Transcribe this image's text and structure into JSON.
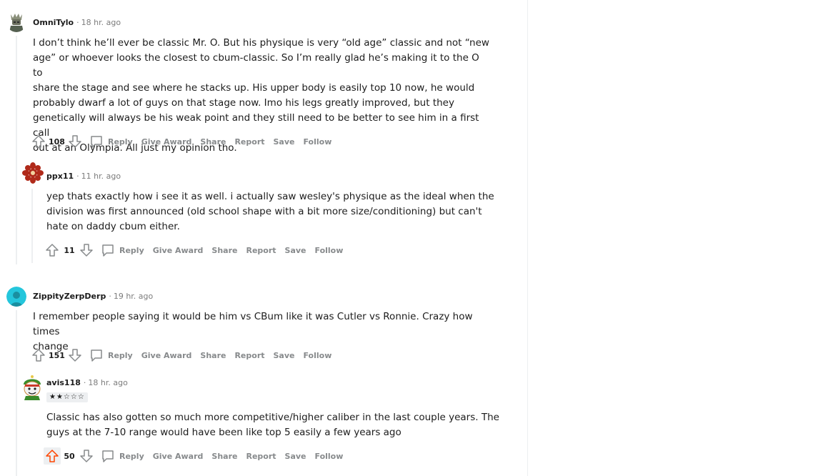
{
  "comments": [
    {
      "author": "OmniTylo",
      "time": "18 hr. ago",
      "body_lines": [
        "I don’t think he’ll ever be classic Mr. O. But his physique is very “old age” classic and not “new",
        "age” or whoever looks the closest to cbum-classic. So I’m really glad he’s making it to the O to",
        "share the stage and see where he stacks up. His upper body is easily top 10 now, he would",
        "probably dwarf a lot of guys on that stage now. Imo his legs greatly improved, but they",
        "genetically will always be his weak point and they still need to be better to see him in a first call",
        "out at an Olympia. All just my opinion tho."
      ],
      "votes": "108"
    },
    {
      "author": "ppx11",
      "time": "11 hr. ago",
      "body_lines": [
        "yep thats exactly how i see it as well. i actually saw wesley's physique as the ideal when the",
        "division was first announced (old school shape with a bit more size/conditioning) but can't",
        "hate on daddy cbum either."
      ],
      "votes": "11"
    },
    {
      "author": "ZippityZerpDerp",
      "time": "19 hr. ago",
      "body_lines": [
        "I remember people saying it would be him vs CBum like it was Cutler vs Ronnie. Crazy how times",
        "change"
      ],
      "votes": "151"
    },
    {
      "author": "avis118",
      "time": "18 hr. ago",
      "flair": "★★☆☆☆",
      "body_lines": [
        "Classic has also gotten so much more competitive/higher caliber in the last couple years. The",
        "guys at the 7-10 range would have been like top 5 easily a few years ago"
      ],
      "votes": "50"
    }
  ],
  "actions": {
    "reply": "Reply",
    "give_award": "Give Award",
    "share": "Share",
    "report": "Report",
    "save": "Save",
    "follow": "Follow"
  },
  "meta_separator": "·",
  "colors": {
    "upvote_active": "#ff4500",
    "text_muted": "#878a8c",
    "thread_line": "#edeff1"
  }
}
